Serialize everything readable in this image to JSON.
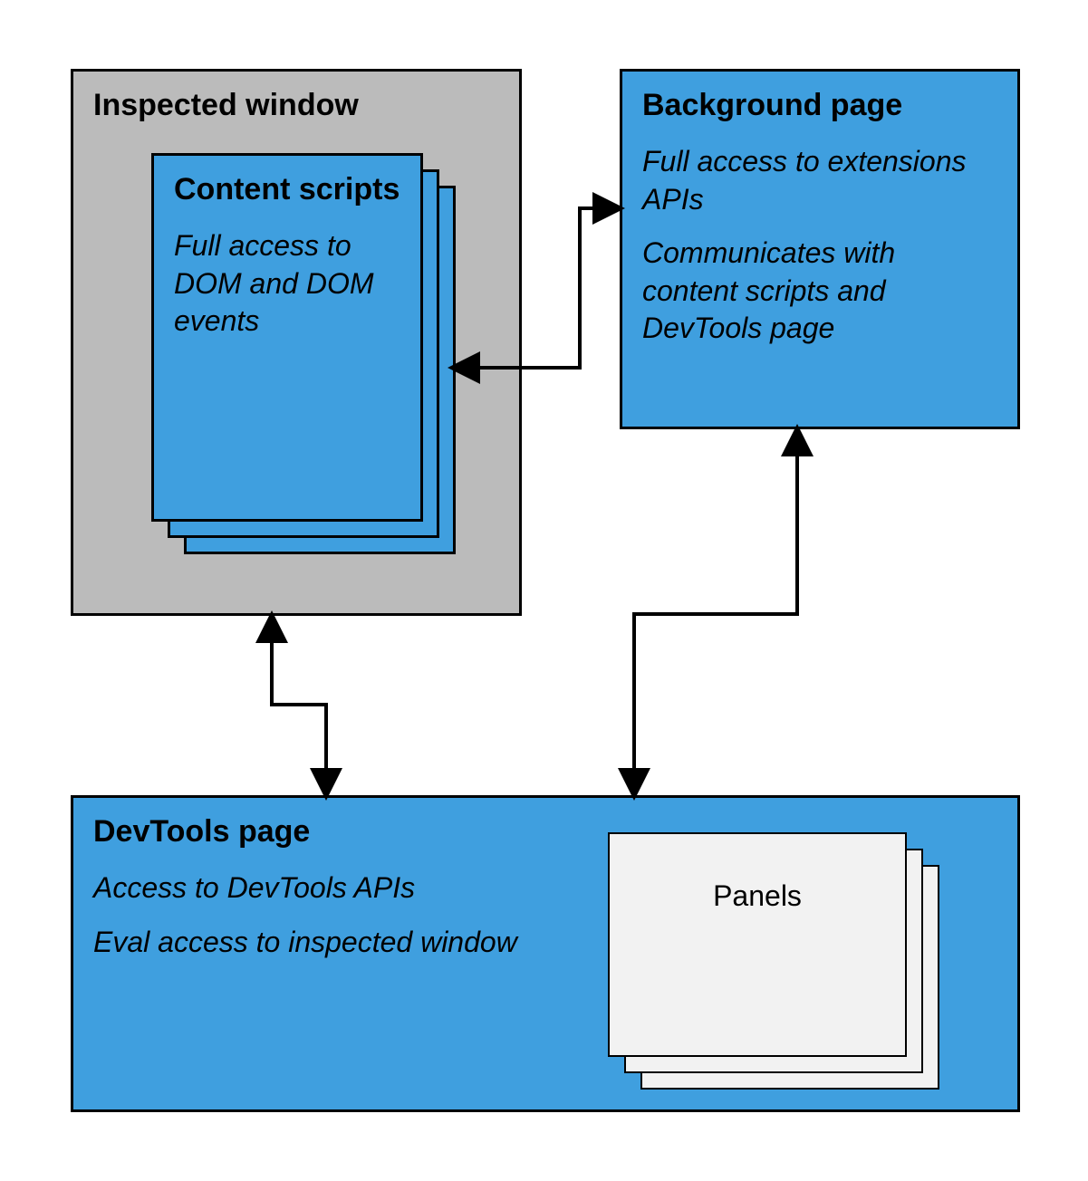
{
  "colors": {
    "blue": "#3f9fdf",
    "gray": "#bbbbbb",
    "white": "#f2f2f2",
    "stroke": "#000000"
  },
  "inspected": {
    "title": "Inspected window",
    "content": {
      "title": "Content scripts",
      "desc": "Full access to DOM and DOM events"
    }
  },
  "background": {
    "title": "Background page",
    "desc1": "Full access to extensions APIs",
    "desc2": "Communicates with content scripts and DevTools page"
  },
  "devtools": {
    "title": "DevTools page",
    "desc1": "Access to DevTools APIs",
    "desc2": "Eval access to inspected window",
    "panels": "Panels"
  }
}
